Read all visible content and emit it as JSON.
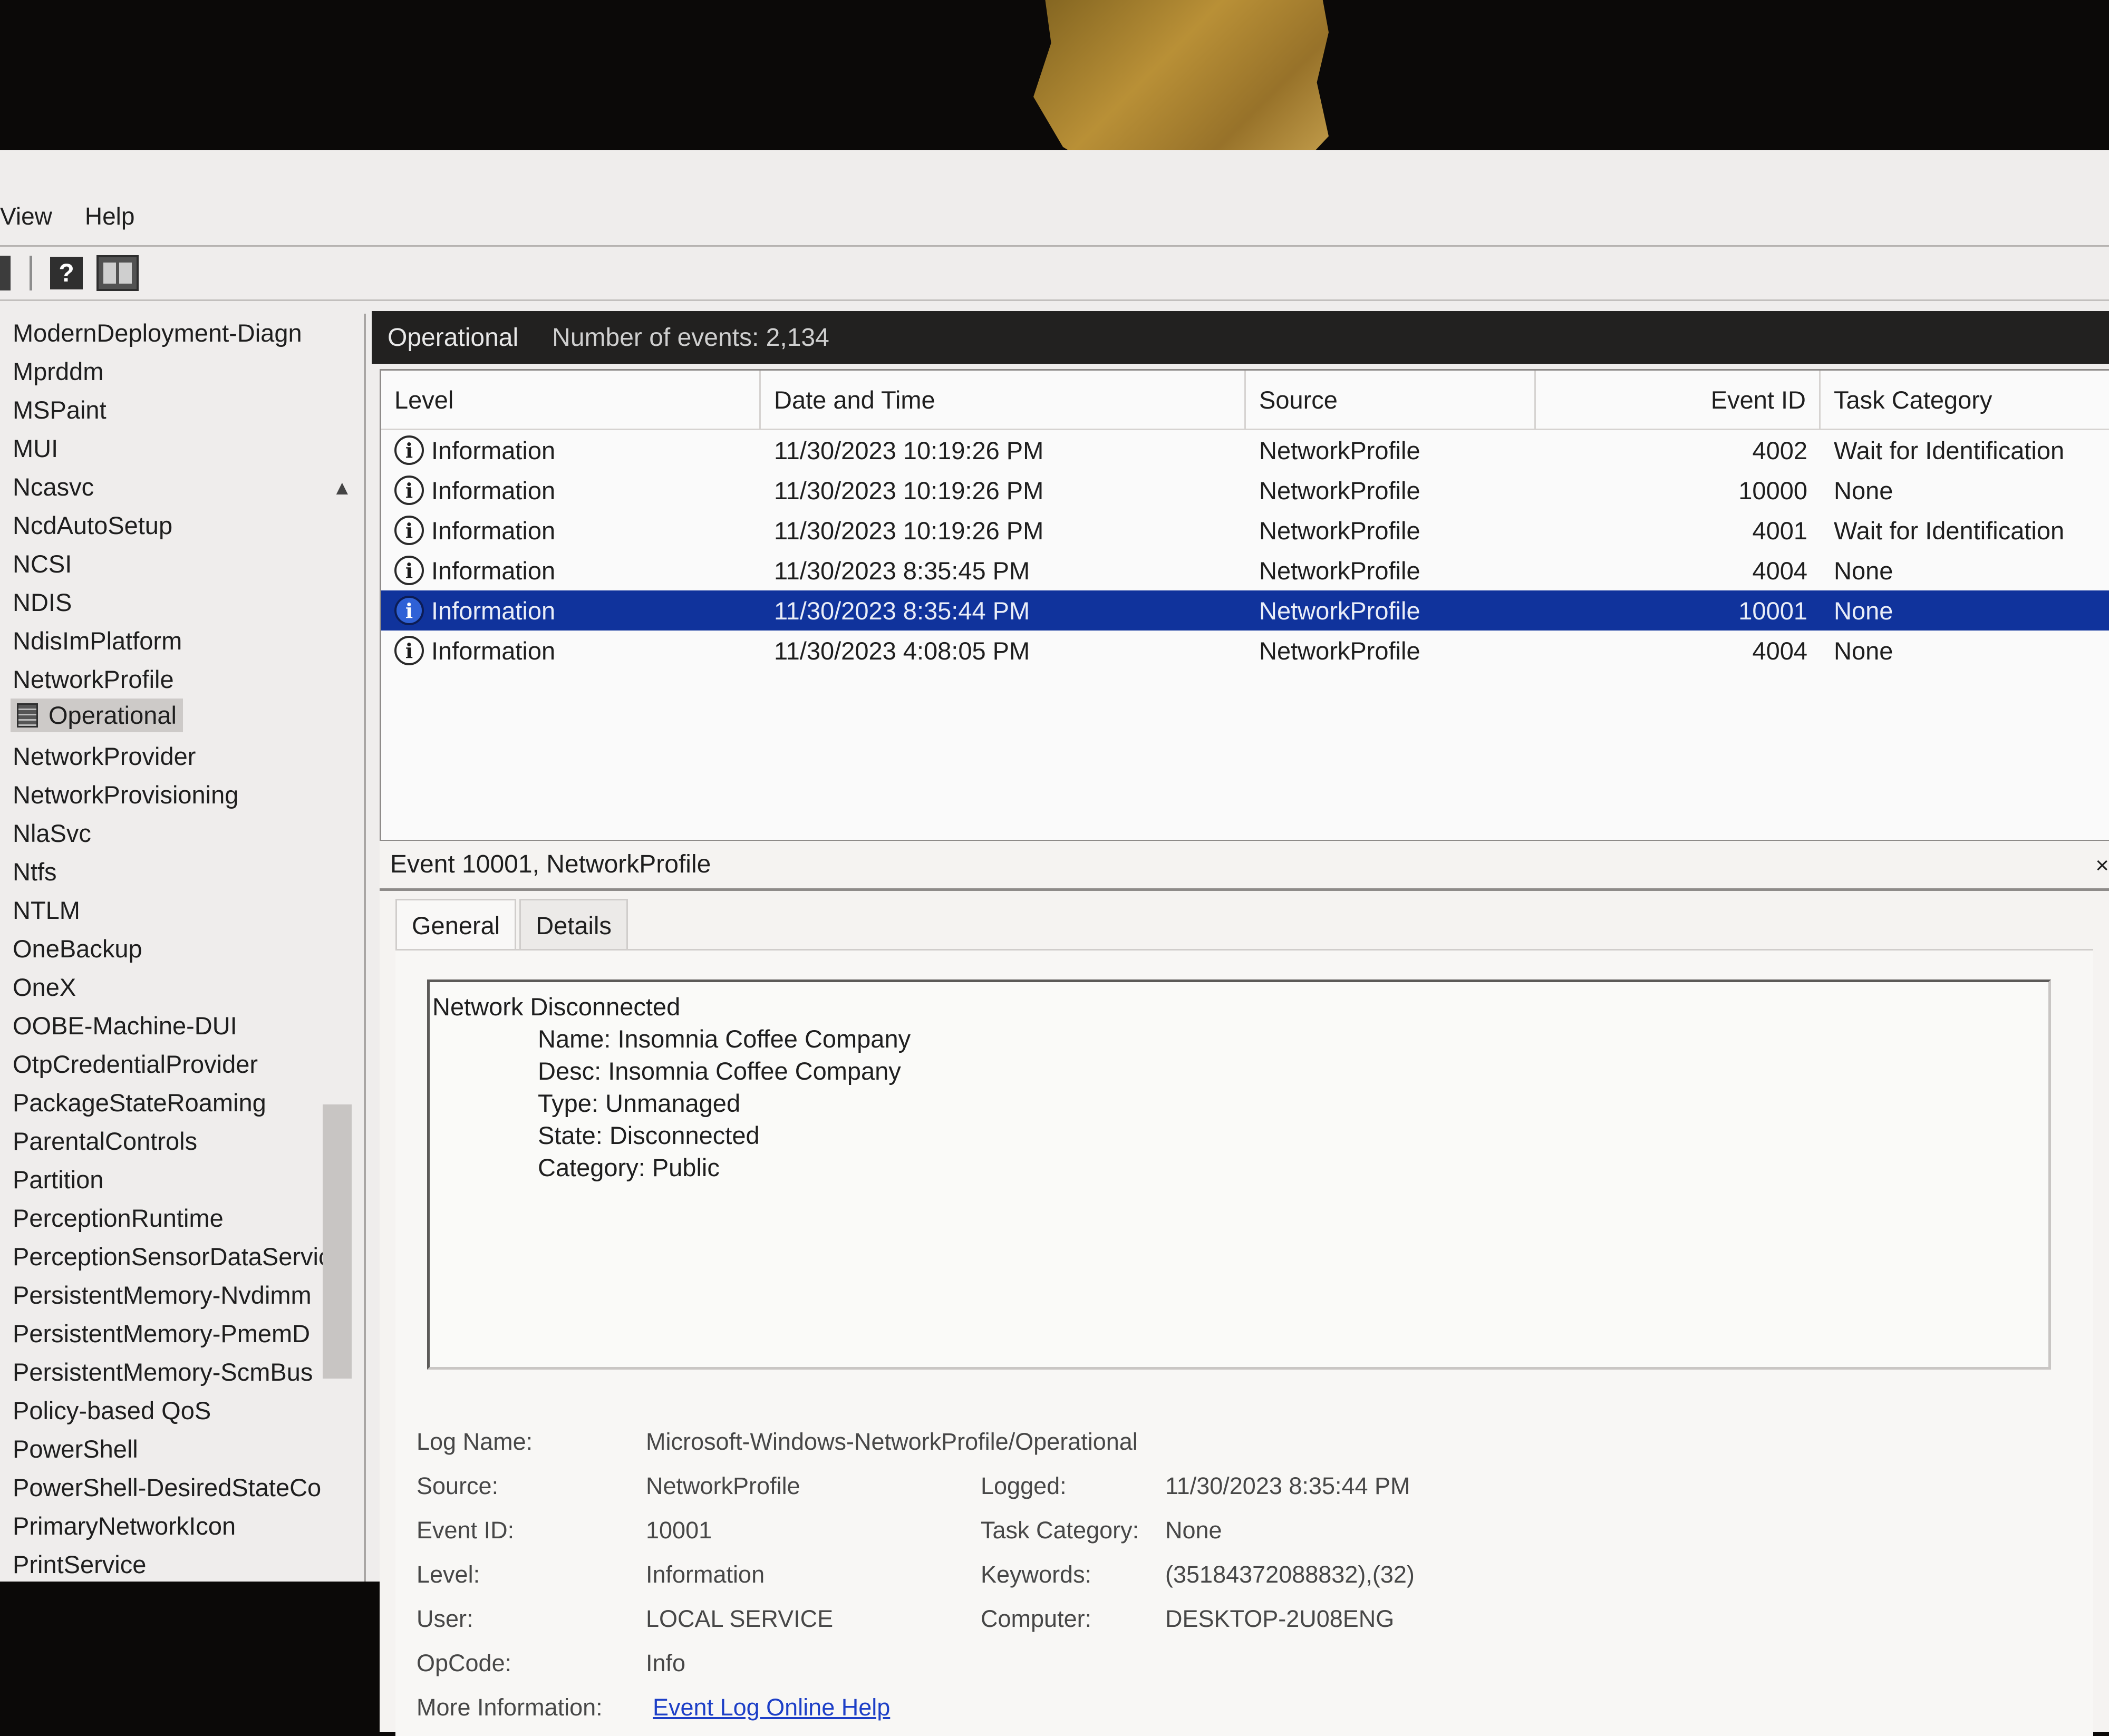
{
  "menubar": {
    "view": "View",
    "help": "Help"
  },
  "tree": {
    "items": [
      "ModernDeployment-Diagn",
      "Mprddm",
      "MSPaint",
      "MUI",
      "Ncasvc",
      "NcdAutoSetup",
      "NCSI",
      "NDIS",
      "NdisImPlatform",
      "NetworkProfile"
    ],
    "selected": "Operational",
    "items_after": [
      "NetworkProvider",
      "NetworkProvisioning",
      "NlaSvc",
      "Ntfs",
      "NTLM",
      "OneBackup",
      "OneX",
      "OOBE-Machine-DUI",
      "OtpCredentialProvider",
      "PackageStateRoaming",
      "ParentalControls",
      "Partition",
      "PerceptionRuntime",
      "PerceptionSensorDataServic",
      "PersistentMemory-Nvdimm",
      "PersistentMemory-PmemD",
      "PersistentMemory-ScmBus",
      "Policy-based QoS",
      "PowerShell",
      "PowerShell-DesiredStateCo",
      "PrimaryNetworkIcon",
      "PrintService"
    ]
  },
  "events": {
    "log_name": "Operational",
    "count_label": "Number of events: 2,134",
    "columns": [
      "Level",
      "Date and Time",
      "Source",
      "Event ID",
      "Task Category"
    ],
    "rows": [
      {
        "level": "Information",
        "date": "11/30/2023 10:19:26 PM",
        "source": "NetworkProfile",
        "event_id": "4002",
        "task": "Wait for Identification"
      },
      {
        "level": "Information",
        "date": "11/30/2023 10:19:26 PM",
        "source": "NetworkProfile",
        "event_id": "10000",
        "task": "None"
      },
      {
        "level": "Information",
        "date": "11/30/2023 10:19:26 PM",
        "source": "NetworkProfile",
        "event_id": "4001",
        "task": "Wait for Identification"
      },
      {
        "level": "Information",
        "date": "11/30/2023 8:35:45 PM",
        "source": "NetworkProfile",
        "event_id": "4004",
        "task": "None"
      },
      {
        "level": "Information",
        "date": "11/30/2023 8:35:44 PM",
        "source": "NetworkProfile",
        "event_id": "10001",
        "task": "None",
        "selected": true
      },
      {
        "level": "Information",
        "date": "11/30/2023 4:08:05 PM",
        "source": "NetworkProfile",
        "event_id": "4004",
        "task": "None"
      }
    ]
  },
  "detail": {
    "title": "Event 10001, NetworkProfile",
    "tabs": {
      "general": "General",
      "details": "Details"
    },
    "message": {
      "heading": "Network Disconnected",
      "lines": [
        "Name: Insomnia Coffee Company",
        "Desc: Insomnia Coffee Company",
        "Type: Unmanaged",
        "State: Disconnected",
        "Category: Public"
      ]
    },
    "props": {
      "log_name_label": "Log Name:",
      "log_name": "Microsoft-Windows-NetworkProfile/Operational",
      "source_label": "Source:",
      "source": "NetworkProfile",
      "logged_label": "Logged:",
      "logged": "11/30/2023 8:35:44 PM",
      "event_id_label": "Event ID:",
      "event_id": "10001",
      "task_category_label": "Task Category:",
      "task_category": "None",
      "level_label": "Level:",
      "level": "Information",
      "keywords_label": "Keywords:",
      "keywords": "(35184372088832),(32)",
      "user_label": "User:",
      "user": "LOCAL SERVICE",
      "computer_label": "Computer:",
      "computer": "DESKTOP-2U08ENG",
      "opcode_label": "OpCode:",
      "opcode": "Info",
      "more_info_label": "More Information:",
      "more_info_link": "Event Log Online Help"
    }
  }
}
